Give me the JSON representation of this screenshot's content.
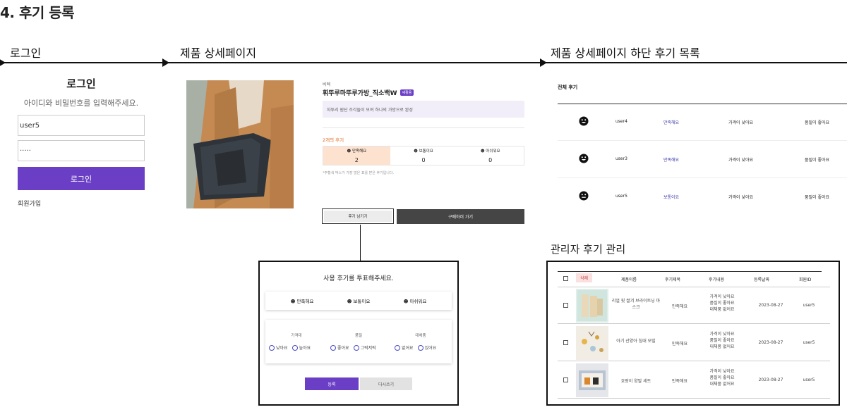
{
  "title": "4. 후기 등록",
  "steps": [
    "로그인",
    "제품 상세페이지",
    "제품 상세페이지 하단 후기 목록"
  ],
  "login": {
    "title": "로그인",
    "subtitle": "아이디와 비밀번호를 입력해주세요.",
    "username": "user5",
    "password": "·····",
    "button": "로그인",
    "signup": "회원가입"
  },
  "product": {
    "brand": "비펙",
    "name": "휘뚜루마뚜루가방_직소백W",
    "badge": "새활용",
    "description": "자투리 원단 조각들이 모여 하나의 가방으로 완성",
    "review_count": "2개의 후기",
    "votes": [
      {
        "label": "만족해요",
        "count": "2"
      },
      {
        "label": "보통이요",
        "count": "0"
      },
      {
        "label": "아쉬워요",
        "count": "0"
      }
    ],
    "note": "*주황색 박스가 가장 많은 표를 받은 후기입니다.",
    "write_review": "후기 남기기",
    "buy": "구매하러 가기"
  },
  "modal": {
    "title": "사용 후기를 투표해주세요.",
    "options": [
      "만족해요",
      "보통이요",
      "아쉬워요"
    ],
    "columns": [
      {
        "label": "가격대",
        "choices": [
          "낮아요",
          "높아요"
        ]
      },
      {
        "label": "품질",
        "choices": [
          "좋아요",
          "그럭저럭"
        ]
      },
      {
        "label": "대체품",
        "choices": [
          "없어요",
          "있어요"
        ]
      }
    ],
    "submit": "등록",
    "reset": "다시쓰기"
  },
  "reviews": {
    "header": "전체 후기",
    "rows": [
      {
        "user": "user4",
        "rating": "만족해요",
        "price": "가격이 낮아요",
        "quality": "품질이 좋아요",
        "face": "happy"
      },
      {
        "user": "user3",
        "rating": "만족해요",
        "price": "가격이 낮아요",
        "quality": "품질이 좋아요",
        "face": "happy"
      },
      {
        "user": "user5",
        "rating": "보통이요",
        "price": "가격이 낮아요",
        "quality": "품질이 좋아요",
        "face": "neutral"
      }
    ]
  },
  "admin": {
    "title": "관리자 후기 관리",
    "delete": "삭제",
    "headers": [
      "제품이름",
      "후기제목",
      "후기내용",
      "등록날짜",
      "회원ID"
    ],
    "rows": [
      {
        "product": "리얼 핏 쌀겨 브라이트닝 마스크",
        "title": "만족해요",
        "content": [
          "가격이 낮아요",
          "품질이 좋아요",
          "대체품 없어요"
        ],
        "date": "2023-08-27",
        "user": "user5"
      },
      {
        "product": "아기 산양아 침대 모빌",
        "title": "만족해요",
        "content": [
          "가격이 낮아요",
          "품질이 좋아요",
          "대체품 없어요"
        ],
        "date": "2023-08-27",
        "user": "user5"
      },
      {
        "product": "호랑이 양말 세트",
        "title": "만족해요",
        "content": [
          "가격이 낮아요",
          "품질이 좋아요",
          "대체품 없어요"
        ],
        "date": "2023-08-27",
        "user": "user5"
      }
    ]
  },
  "colors": {
    "accent": "#6a3fc5",
    "highlight": "#fde2cf",
    "rating": "#3a3aa8"
  }
}
